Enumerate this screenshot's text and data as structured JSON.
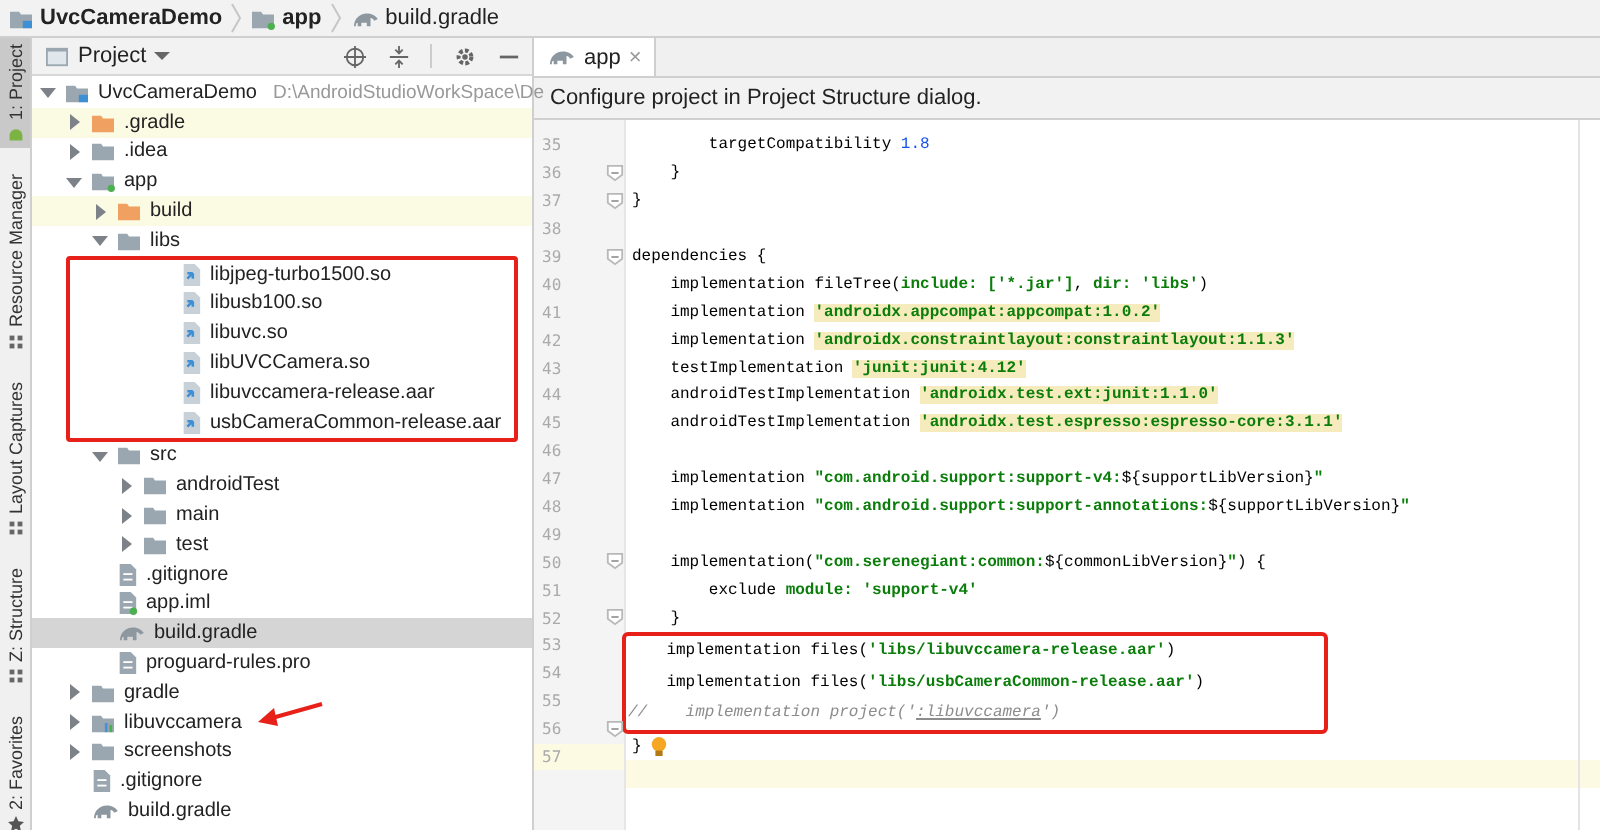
{
  "breadcrumbs": [
    {
      "label": "UvcCameraDemo",
      "kind": "module"
    },
    {
      "label": "app",
      "kind": "appmodule"
    },
    {
      "label": "build.gradle",
      "kind": "gradle"
    }
  ],
  "tool_windows": [
    {
      "label": "1: Project",
      "selected": true,
      "kind": "android"
    },
    {
      "label": "Resource Manager",
      "selected": false,
      "kind": "grid"
    },
    {
      "label": "Layout Captures",
      "selected": false,
      "kind": "grid"
    },
    {
      "label": "Z: Structure",
      "selected": false,
      "kind": "grid"
    },
    {
      "label": "2: Favorites",
      "selected": false,
      "kind": "star"
    }
  ],
  "project_panel": {
    "title": "Project",
    "tree": [
      {
        "label": "UvcCameraDemo",
        "path": "D:\\AndroidStudioWorkSpace\\De",
        "kind": "module",
        "expanded": true,
        "selected": false,
        "children": [
          {
            "label": ".gradle",
            "kind": "excluded",
            "expanded": false,
            "selected": false
          },
          {
            "label": ".idea",
            "kind": "folder",
            "expanded": false,
            "selected": false
          },
          {
            "label": "app",
            "kind": "appmodule",
            "expanded": true,
            "selected": false,
            "children": [
              {
                "label": "build",
                "kind": "excluded",
                "expanded": false,
                "selected": false
              },
              {
                "label": "libs",
                "kind": "folder",
                "expanded": true,
                "selected": false,
                "boxed": true,
                "children": [
                  {
                    "label": "libjpeg-turbo1500.so",
                    "kind": "library",
                    "selected": false
                  },
                  {
                    "label": "libusb100.so",
                    "kind": "library",
                    "selected": false
                  },
                  {
                    "label": "libuvc.so",
                    "kind": "library",
                    "selected": false
                  },
                  {
                    "label": "libUVCCamera.so",
                    "kind": "library",
                    "selected": false
                  },
                  {
                    "label": "libuvccamera-release.aar",
                    "kind": "library",
                    "selected": false
                  },
                  {
                    "label": "usbCameraCommon-release.aar",
                    "kind": "library",
                    "selected": false
                  }
                ]
              },
              {
                "label": "src",
                "kind": "folder",
                "expanded": true,
                "selected": false,
                "children": [
                  {
                    "label": "androidTest",
                    "kind": "folder",
                    "expanded": false,
                    "selected": false
                  },
                  {
                    "label": "main",
                    "kind": "folder",
                    "expanded": false,
                    "selected": false
                  },
                  {
                    "label": "test",
                    "kind": "folder",
                    "expanded": false,
                    "selected": false
                  }
                ]
              },
              {
                "label": ".gitignore",
                "kind": "file",
                "selected": false
              },
              {
                "label": "app.iml",
                "kind": "iml",
                "selected": false
              },
              {
                "label": "build.gradle",
                "kind": "gradle",
                "selected": true
              },
              {
                "label": "proguard-rules.pro",
                "kind": "file",
                "selected": false
              }
            ]
          },
          {
            "label": "gradle",
            "kind": "folder",
            "expanded": false,
            "selected": false
          },
          {
            "label": "libuvccamera",
            "kind": "libmodule",
            "expanded": false,
            "selected": false,
            "arrow": true
          },
          {
            "label": "screenshots",
            "kind": "folder",
            "expanded": false,
            "selected": false
          },
          {
            "label": ".gitignore",
            "kind": "file",
            "selected": false
          },
          {
            "label": "build.gradle",
            "kind": "gradle",
            "selected": false
          }
        ]
      }
    ]
  },
  "editor": {
    "tab": {
      "label": "app",
      "close": "×",
      "selected": true
    },
    "notification": "Configure project in Project Structure dialog.",
    "groups": [
      {
        "boxed": false,
        "lines": [
          {
            "n": "35",
            "fold": false,
            "segs": [
              {
                "text": "        targetCompatibility ",
                "kind": "plain"
              },
              {
                "text": "1.8",
                "kind": "number"
              }
            ]
          },
          {
            "n": "36",
            "fold": true,
            "segs": [
              {
                "text": "    }",
                "kind": "plain"
              }
            ]
          },
          {
            "n": "37",
            "fold": true,
            "segs": [
              {
                "text": "}",
                "kind": "plain"
              }
            ]
          },
          {
            "n": "38",
            "fold": false
          },
          {
            "n": "39",
            "fold": true,
            "segs": [
              {
                "text": "dependencies {",
                "kind": "plain"
              }
            ]
          },
          {
            "n": "40",
            "fold": false,
            "segs": [
              {
                "text": "    implementation fileTree(",
                "kind": "plain"
              },
              {
                "text": "include: ",
                "kind": "argument"
              },
              {
                "text": "['*.jar']",
                "kind": "string"
              },
              {
                "text": ", ",
                "kind": "plain"
              },
              {
                "text": "dir: ",
                "kind": "argument"
              },
              {
                "text": "'libs'",
                "kind": "string"
              },
              {
                "text": ")",
                "kind": "plain"
              }
            ]
          },
          {
            "n": "41",
            "fold": false,
            "segs": [
              {
                "text": "    implementation ",
                "kind": "plain"
              },
              {
                "text": "'androidx.appcompat:appcompat:1.0.2'",
                "kind": "marked"
              }
            ]
          },
          {
            "n": "42",
            "fold": false,
            "segs": [
              {
                "text": "    implementation ",
                "kind": "plain"
              },
              {
                "text": "'androidx.constraintlayout:constraintlayout:1.1.3'",
                "kind": "marked"
              }
            ]
          },
          {
            "n": "43",
            "fold": false,
            "segs": [
              {
                "text": "    testImplementation ",
                "kind": "plain"
              },
              {
                "text": "'junit:junit:4.12'",
                "kind": "marked"
              }
            ]
          },
          {
            "n": "44",
            "fold": false,
            "segs": [
              {
                "text": "    androidTestImplementation ",
                "kind": "plain"
              },
              {
                "text": "'androidx.test.ext:junit:1.1.0'",
                "kind": "marked"
              }
            ]
          },
          {
            "n": "45",
            "fold": false,
            "segs": [
              {
                "text": "    androidTestImplementation ",
                "kind": "plain"
              },
              {
                "text": "'androidx.test.espresso:espresso-core:3.1.1'",
                "kind": "marked"
              }
            ]
          },
          {
            "n": "46",
            "fold": false
          },
          {
            "n": "47",
            "fold": false,
            "segs": [
              {
                "text": "    implementation ",
                "kind": "plain"
              },
              {
                "text": "\"com.android.support:support-v4:",
                "kind": "string"
              },
              {
                "text": "${supportLibVersion}",
                "kind": "plain"
              },
              {
                "text": "\"",
                "kind": "string"
              }
            ]
          },
          {
            "n": "48",
            "fold": false,
            "segs": [
              {
                "text": "    implementation ",
                "kind": "plain"
              },
              {
                "text": "\"com.android.support:support-annotations:",
                "kind": "string"
              },
              {
                "text": "${supportLibVersion}",
                "kind": "plain"
              },
              {
                "text": "\"",
                "kind": "string"
              }
            ]
          },
          {
            "n": "49",
            "fold": false
          },
          {
            "n": "50",
            "fold": true,
            "segs": [
              {
                "text": "    implementation(",
                "kind": "plain"
              },
              {
                "text": "\"com.serenegiant:common:",
                "kind": "string"
              },
              {
                "text": "${commonLibVersion}",
                "kind": "plain"
              },
              {
                "text": "\"",
                "kind": "string"
              },
              {
                "text": ") {",
                "kind": "plain"
              }
            ]
          },
          {
            "n": "51",
            "fold": false,
            "segs": [
              {
                "text": "        exclude ",
                "kind": "plain"
              },
              {
                "text": "module: ",
                "kind": "argument"
              },
              {
                "text": "'support-v4'",
                "kind": "string"
              }
            ]
          },
          {
            "n": "52",
            "fold": true,
            "segs": [
              {
                "text": "    }",
                "kind": "plain"
              }
            ]
          }
        ]
      },
      {
        "boxed": true,
        "lines": [
          {
            "n": "53",
            "fold": false,
            "segs": [
              {
                "text": "    implementation files(",
                "kind": "plain"
              },
              {
                "text": "'libs/libuvccamera-release.aar'",
                "kind": "string"
              },
              {
                "text": ")",
                "kind": "plain"
              }
            ]
          },
          {
            "n": "54",
            "fold": false,
            "segs": [
              {
                "text": "    implementation files(",
                "kind": "plain"
              },
              {
                "text": "'libs/usbCameraCommon-release.aar'",
                "kind": "string"
              },
              {
                "text": ")",
                "kind": "plain"
              }
            ]
          },
          {
            "n": "55",
            "fold": false,
            "segs": [
              {
                "text": "//    implementation project('",
                "kind": "comment"
              },
              {
                "text": ":libuvccamera",
                "kind": "reference"
              },
              {
                "text": "')",
                "kind": "comment"
              }
            ]
          }
        ]
      },
      {
        "boxed": false,
        "lines": [
          {
            "n": "56",
            "fold": true,
            "bulb": true,
            "segs": [
              {
                "text": "}",
                "kind": "plain"
              }
            ]
          },
          {
            "n": "57",
            "fold": false,
            "current": true
          }
        ]
      }
    ]
  }
}
